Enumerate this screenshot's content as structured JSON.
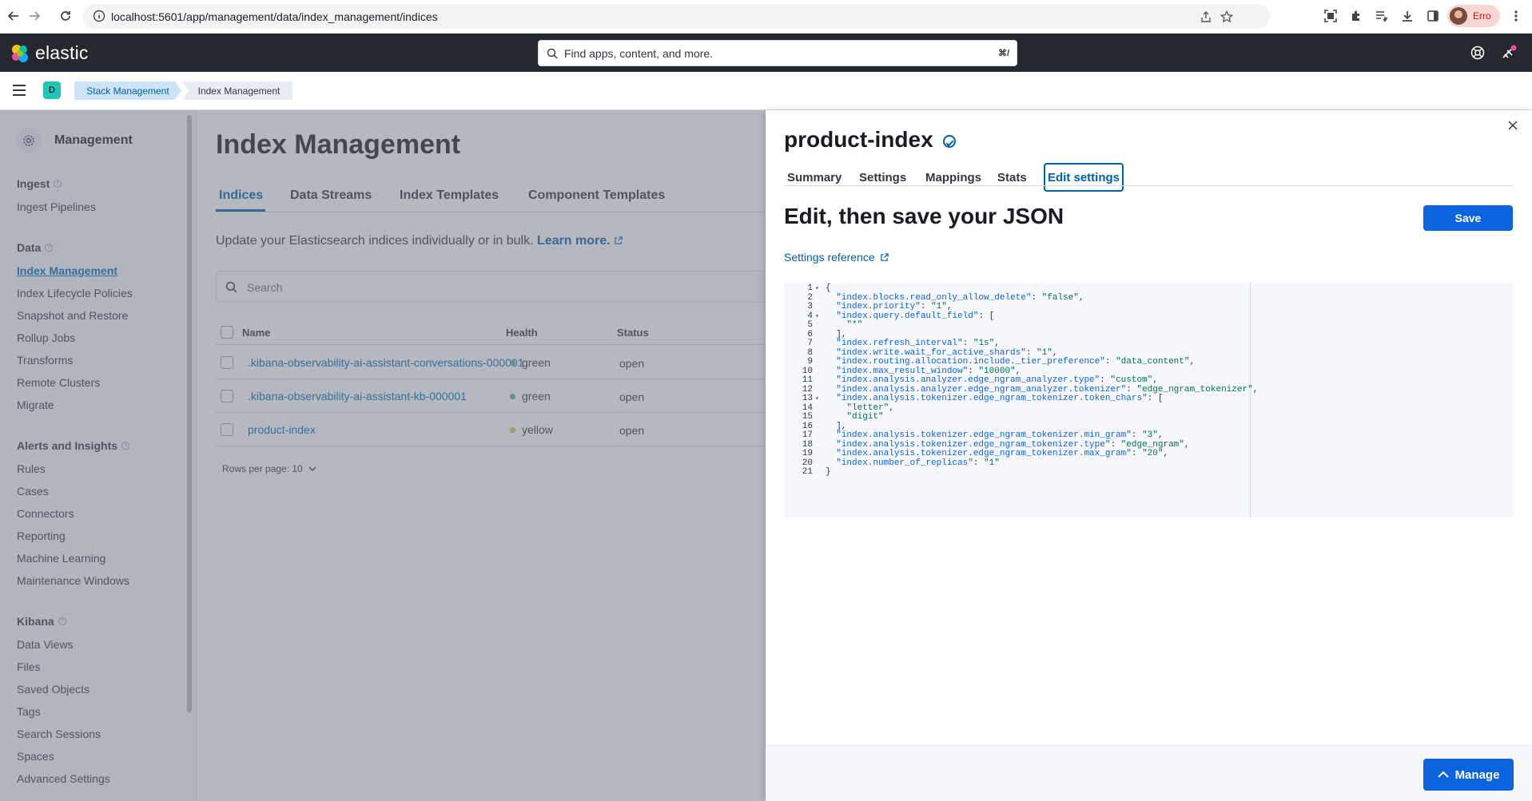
{
  "browser": {
    "url": "localhost:5601/app/management/data/index_management/indices",
    "profile_name": "Erro"
  },
  "header": {
    "logo_text": "elastic",
    "search_placeholder": "Find apps, content, and more.",
    "search_shortcut": "⌘/"
  },
  "breadcrumbs": {
    "space_initial": "D",
    "items": [
      "Stack Management",
      "Index Management"
    ]
  },
  "sidebar": {
    "title": "Management",
    "groups": [
      {
        "label": "Ingest",
        "items": [
          "Ingest Pipelines"
        ]
      },
      {
        "label": "Data",
        "items": [
          "Index Management",
          "Index Lifecycle Policies",
          "Snapshot and Restore",
          "Rollup Jobs",
          "Transforms",
          "Remote Clusters",
          "Migrate"
        ]
      },
      {
        "label": "Alerts and Insights",
        "items": [
          "Rules",
          "Cases",
          "Connectors",
          "Reporting",
          "Machine Learning",
          "Maintenance Windows"
        ]
      },
      {
        "label": "Kibana",
        "items": [
          "Data Views",
          "Files",
          "Saved Objects",
          "Tags",
          "Search Sessions",
          "Spaces",
          "Advanced Settings"
        ]
      }
    ],
    "active_item": "Index Management"
  },
  "main": {
    "title": "Index Management",
    "tabs": [
      "Indices",
      "Data Streams",
      "Index Templates",
      "Component Templates"
    ],
    "description": "Update your Elasticsearch indices individually or in bulk.",
    "learn_more": "Learn more.",
    "search_placeholder": "Search",
    "columns": [
      "Name",
      "Health",
      "Status"
    ],
    "rows": [
      {
        "name": ".kibana-observability-ai-assistant-conversations-000001",
        "health": "green",
        "status": "open"
      },
      {
        "name": ".kibana-observability-ai-assistant-kb-000001",
        "health": "green",
        "status": "open"
      },
      {
        "name": "product-index",
        "health": "yellow",
        "status": "open"
      }
    ],
    "rows_per_page": "Rows per page: 10"
  },
  "flyout": {
    "title": "product-index",
    "tabs": [
      "Summary",
      "Settings",
      "Mappings",
      "Stats",
      "Edit settings"
    ],
    "active_tab": "Edit settings",
    "heading": "Edit, then save your JSON",
    "save_label": "Save",
    "settings_reference": "Settings reference",
    "manage_label": "Manage",
    "code_lines": [
      "{",
      "  \"index.blocks.read_only_allow_delete\": \"false\",",
      "  \"index.priority\": \"1\",",
      "  \"index.query.default_field\": [",
      "    \"*\"",
      "  ],",
      "  \"index.refresh_interval\": \"1s\",",
      "  \"index.write.wait_for_active_shards\": \"1\",",
      "  \"index.routing.allocation.include._tier_preference\": \"data_content\",",
      "  \"index.max_result_window\": \"10000\",",
      "  \"index.analysis.analyzer.edge_ngram_analyzer.type\": \"custom\",",
      "  \"index.analysis.analyzer.edge_ngram_analyzer.tokenizer\": \"edge_ngram_tokenizer\",",
      "  \"index.analysis.tokenizer.edge_ngram_tokenizer.token_chars\": [",
      "    \"letter\",",
      "    \"digit\"",
      "  ],",
      "  \"index.analysis.tokenizer.edge_ngram_tokenizer.min_gram\": \"3\",",
      "  \"index.analysis.tokenizer.edge_ngram_tokenizer.type\": \"edge_ngram\",",
      "  \"index.analysis.tokenizer.edge_ngram_tokenizer.max_gram\": \"20\",",
      "  \"index.number_of_replicas\": \"1\"",
      "}"
    ],
    "fold_lines": [
      1,
      4,
      13
    ]
  },
  "colors": {
    "primary": "#0b64dd",
    "link": "#006bb8",
    "health_green": "#54b399",
    "health_yellow": "#d6bf57",
    "header_bg": "#25282f"
  }
}
